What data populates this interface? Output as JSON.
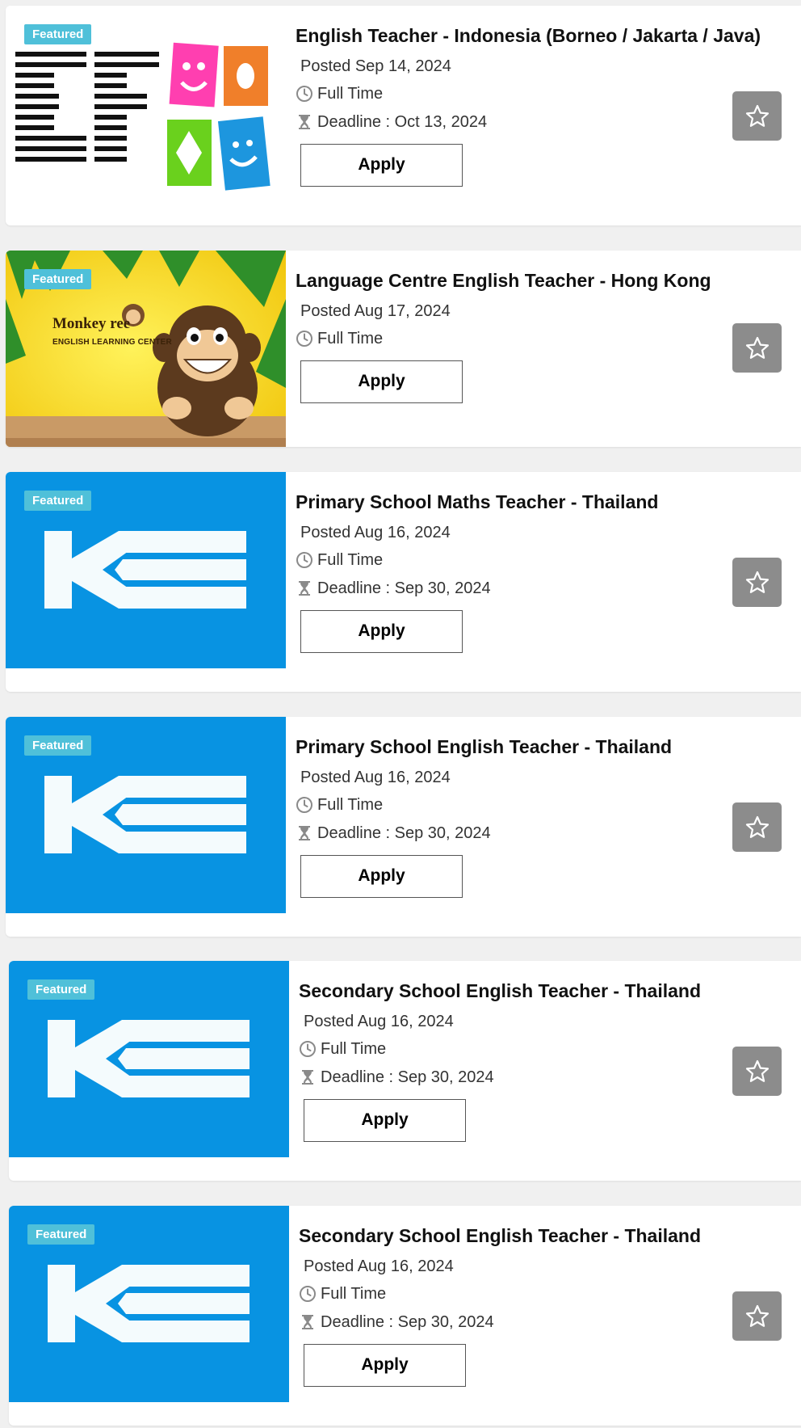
{
  "badge_label": "Featured",
  "apply_label": "Apply",
  "colors": {
    "badge_bg": "#4fc0d9",
    "ke_blue": "#0893e2",
    "fav_bg": "#8c8c8c"
  },
  "jobs": [
    {
      "title": "English Teacher - Indonesia (Borneo / Jakarta / Java)",
      "posted": "Posted Sep 14, 2024",
      "type": "Full Time",
      "deadline": "Deadline : Oct 13, 2024",
      "logo": "ef-logo"
    },
    {
      "title": "Language Centre English Teacher - Hong Kong",
      "posted": "Posted Aug 17, 2024",
      "type": "Full Time",
      "deadline": "",
      "logo": "monkey-tree-logo",
      "logo_text": [
        "Monkey",
        "ree",
        "ENGLISH LEARNING CENTER"
      ]
    },
    {
      "title": "Primary School Maths Teacher - Thailand",
      "posted": "Posted Aug 16, 2024",
      "type": "Full Time",
      "deadline": "Deadline : Sep 30, 2024",
      "logo": "ke-logo"
    },
    {
      "title": "Primary School English Teacher - Thailand",
      "posted": "Posted Aug 16, 2024",
      "type": "Full Time",
      "deadline": "Deadline : Sep 30, 2024",
      "logo": "ke-logo"
    },
    {
      "title": "Secondary School English Teacher - Thailand",
      "posted": "Posted Aug 16, 2024",
      "type": "Full Time",
      "deadline": "Deadline : Sep 30, 2024",
      "logo": "ke-logo"
    },
    {
      "title": "Secondary School English Teacher - Thailand",
      "posted": "Posted Aug 16, 2024",
      "type": "Full Time",
      "deadline": "Deadline : Sep 30, 2024",
      "logo": "ke-logo"
    }
  ]
}
